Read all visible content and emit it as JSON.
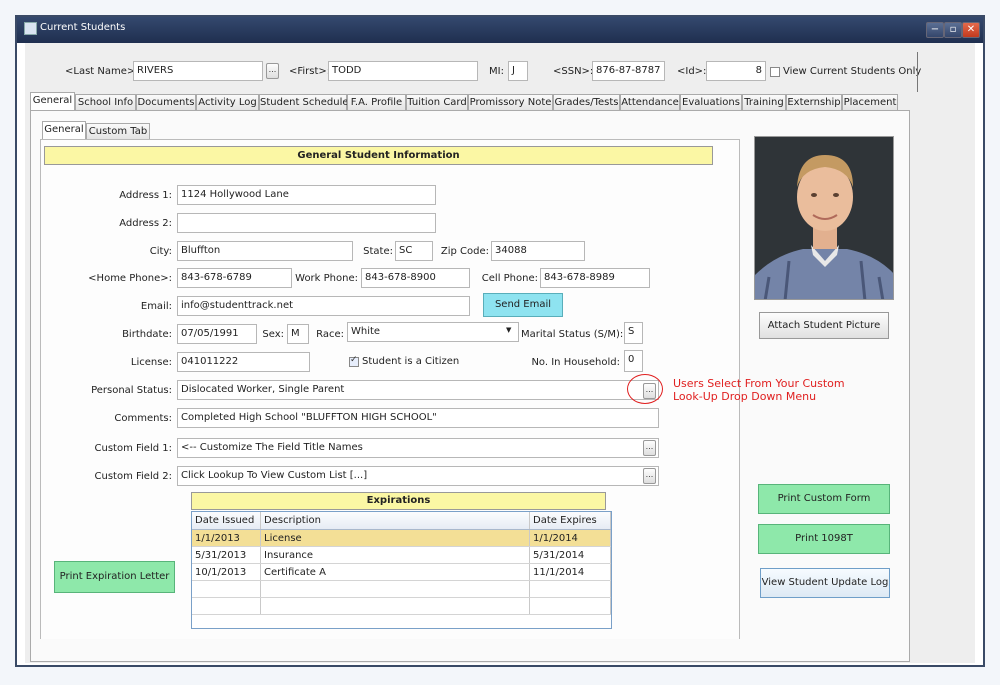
{
  "window": {
    "title": "Current Students",
    "min": "−",
    "max": "▫",
    "close": "✕"
  },
  "search": {
    "last_name_label": "<Last Name>:",
    "last_name": "RIVERS",
    "first_label": "<First>:",
    "first": "TODD",
    "mi_label": "MI:",
    "mi": "J",
    "ssn_label": "<SSN>:",
    "ssn": "876-87-8787",
    "id_label": "<Id>:",
    "id": "8",
    "current_only_label": "View Current Students Only",
    "lookup_btn": "..."
  },
  "tabs": [
    "General",
    "School Info",
    "Documents",
    "Activity Log",
    "Student Schedule",
    "F.A. Profile",
    "Tuition Card",
    "Promissory Note",
    "Grades/Tests",
    "Attendance",
    "Evaluations",
    "Training",
    "Externship",
    "Placement"
  ],
  "subtabs": [
    "General",
    "Custom Tab"
  ],
  "section_title": "General Student Information",
  "form": {
    "address1_label": "Address 1:",
    "address1": "1124 Hollywood Lane",
    "address2_label": "Address 2:",
    "address2": "",
    "city_label": "City:",
    "city": "Bluffton",
    "state_label": "State:",
    "state": "SC",
    "zip_label": "Zip Code:",
    "zip": "34088",
    "home_phone_label": "<Home Phone>:",
    "home_phone": "843-678-6789",
    "work_phone_label": "Work Phone:",
    "work_phone": "843-678-8900",
    "cell_phone_label": "Cell Phone:",
    "cell_phone": "843-678-8989",
    "email_label": "Email:",
    "email": "info@studenttrack.net",
    "send_email": "Send Email",
    "birthdate_label": "Birthdate:",
    "birthdate": "07/05/1991",
    "sex_label": "Sex:",
    "sex": "M",
    "race_label": "Race:",
    "race": "White",
    "marital_label": "Marital Status (S/M):",
    "marital": "S",
    "license_label": "License:",
    "license": "041011222",
    "citizen_label": "Student is a Citizen",
    "household_label": "No. In Household:",
    "household": "0",
    "personal_status_label": "Personal Status:",
    "personal_status": "Dislocated Worker, Single Parent",
    "comments_label": "Comments:",
    "comments": "Completed High School  \"BLUFFTON HIGH SCHOOL\"",
    "custom1_label": "Custom Field 1:",
    "custom1": "<-- Customize The Field Title Names",
    "custom2_label": "Custom Field 2:",
    "custom2": "Click Lookup To View Custom List [...]",
    "lookup_btn": "..."
  },
  "annotation": {
    "line1": "Users Select From Your Custom",
    "line2": "Look-Up Drop Down Menu"
  },
  "expirations": {
    "title": "Expirations",
    "columns": [
      "Date Issued",
      "Description",
      "Date Expires"
    ],
    "rows": [
      [
        "1/1/2013",
        "License",
        "1/1/2014"
      ],
      [
        "5/31/2013",
        "Insurance",
        "5/31/2014"
      ],
      [
        "10/1/2013",
        "Certificate A",
        "11/1/2014"
      ],
      [
        "",
        "",
        ""
      ],
      [
        "",
        "",
        ""
      ]
    ]
  },
  "buttons": {
    "print_expiration": "Print Expiration Letter",
    "attach_picture": "Attach Student Picture",
    "print_custom": "Print Custom Form",
    "print_1098t": "Print 1098T",
    "view_log": "View Student Update Log"
  },
  "colors": {
    "accent_yellow": "#fbf7a4",
    "button_green": "#8ee8aa",
    "button_cyan": "#8ee3f0",
    "annotation_red": "#e02020"
  }
}
